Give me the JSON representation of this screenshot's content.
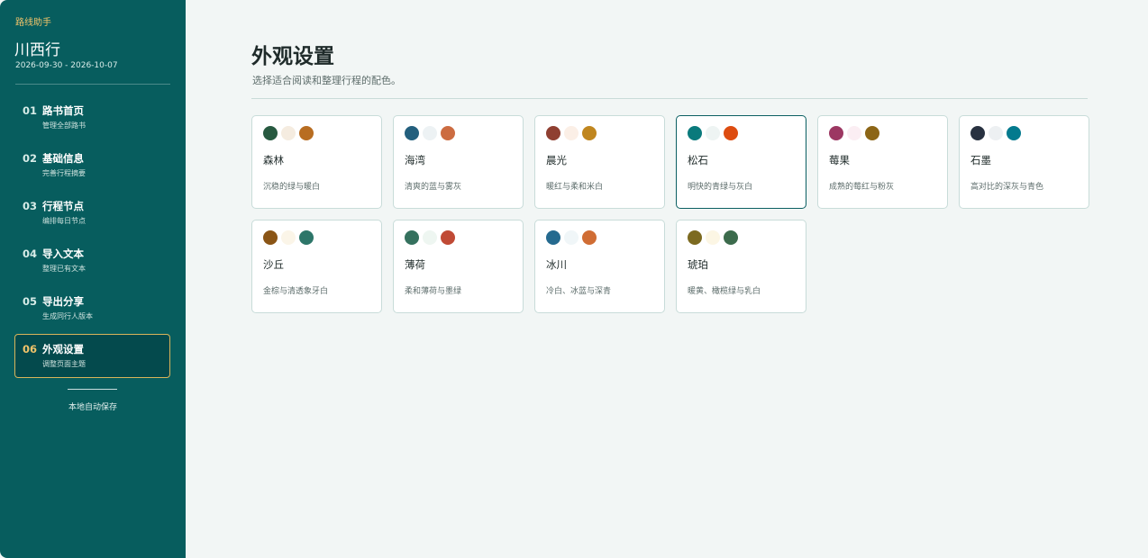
{
  "sidebar": {
    "brand": "路线助手",
    "trip_title": "川西行",
    "trip_dates": "2026-09-30 - 2026-10-07",
    "items": [
      {
        "num": "01",
        "label": "路书首页",
        "sub": "管理全部路书"
      },
      {
        "num": "02",
        "label": "基础信息",
        "sub": "完善行程摘要"
      },
      {
        "num": "03",
        "label": "行程节点",
        "sub": "编排每日节点"
      },
      {
        "num": "04",
        "label": "导入文本",
        "sub": "整理已有文本"
      },
      {
        "num": "05",
        "label": "导出分享",
        "sub": "生成同行人版本"
      },
      {
        "num": "06",
        "label": "外观设置",
        "sub": "调整页面主题"
      }
    ],
    "active_index": 5,
    "autosave": "本地自动保存"
  },
  "main": {
    "title": "外观设置",
    "subtitle": "选择适合阅读和整理行程的配色。"
  },
  "themes": [
    {
      "name": "森林",
      "desc": "沉稳的绿与暖白",
      "colors": [
        "#275940",
        "#f5ece0",
        "#b86d21"
      ]
    },
    {
      "name": "海湾",
      "desc": "清爽的蓝与雾灰",
      "colors": [
        "#235f7d",
        "#edf2f4",
        "#cc6c41"
      ]
    },
    {
      "name": "晨光",
      "desc": "暖红与柔和米白",
      "colors": [
        "#8f3f31",
        "#fbefe6",
        "#c0861f"
      ]
    },
    {
      "name": "松石",
      "desc": "明快的青绿与灰白",
      "colors": [
        "#0a7a7c",
        "#eef4f3",
        "#dd4c10"
      ]
    },
    {
      "name": "莓果",
      "desc": "成熟的莓红与粉灰",
      "colors": [
        "#9c3762",
        "#fbeef3",
        "#8c6516"
      ]
    },
    {
      "name": "石墨",
      "desc": "高对比的深灰与青色",
      "colors": [
        "#283140",
        "#edf0f2",
        "#037a8e"
      ]
    },
    {
      "name": "沙丘",
      "desc": "金棕与清透象牙白",
      "colors": [
        "#8a5516",
        "#fbf5e8",
        "#2d7669"
      ]
    },
    {
      "name": "薄荷",
      "desc": "柔和薄荷与墨绿",
      "colors": [
        "#35715e",
        "#eef6f1",
        "#c04a35"
      ]
    },
    {
      "name": "冰川",
      "desc": "冷白、冰蓝与深青",
      "colors": [
        "#256a8f",
        "#f0f6f8",
        "#d06d34"
      ]
    },
    {
      "name": "琥珀",
      "desc": "暖黄、橄榄绿与乳白",
      "colors": [
        "#7c6a20",
        "#fcf6e4",
        "#3c6b4c"
      ]
    }
  ],
  "selected_theme_index": 3
}
